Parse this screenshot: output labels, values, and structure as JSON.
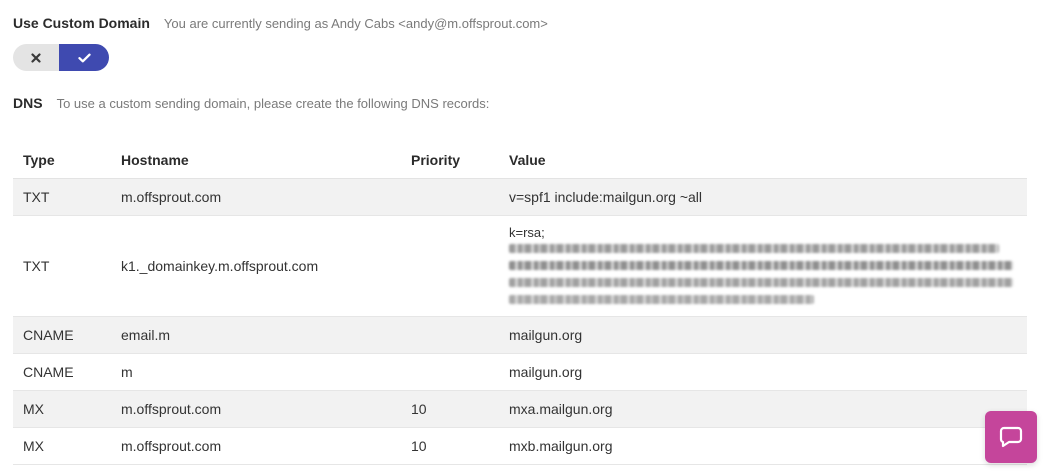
{
  "custom_domain": {
    "title": "Use Custom Domain",
    "note": "You are currently sending as Andy Cabs <andy@m.offsprout.com>",
    "toggle": {
      "off_icon": "x-icon",
      "on_icon": "check-icon",
      "selected": "on",
      "on_color": "#3f4ab0"
    }
  },
  "dns": {
    "title": "DNS",
    "note": "To use a custom sending domain, please create the following DNS records:"
  },
  "table": {
    "headers": {
      "type": "Type",
      "hostname": "Hostname",
      "priority": "Priority",
      "value": "Value"
    },
    "rows": [
      {
        "type": "TXT",
        "hostname": "m.offsprout.com",
        "priority": "",
        "value": "v=spf1 include:mailgun.org ~all"
      },
      {
        "type": "TXT",
        "hostname": "k1._domainkey.m.offsprout.com",
        "priority": "",
        "value": "k=rsa;"
      },
      {
        "type": "CNAME",
        "hostname": "email.m",
        "priority": "",
        "value": "mailgun.org"
      },
      {
        "type": "CNAME",
        "hostname": "m",
        "priority": "",
        "value": "mailgun.org"
      },
      {
        "type": "MX",
        "hostname": "m.offsprout.com",
        "priority": "10",
        "value": "mxa.mailgun.org"
      },
      {
        "type": "MX",
        "hostname": "m.offsprout.com",
        "priority": "10",
        "value": "mxb.mailgun.org"
      }
    ]
  },
  "chat": {
    "icon": "chat-bubble-icon",
    "color": "#c5459b"
  }
}
